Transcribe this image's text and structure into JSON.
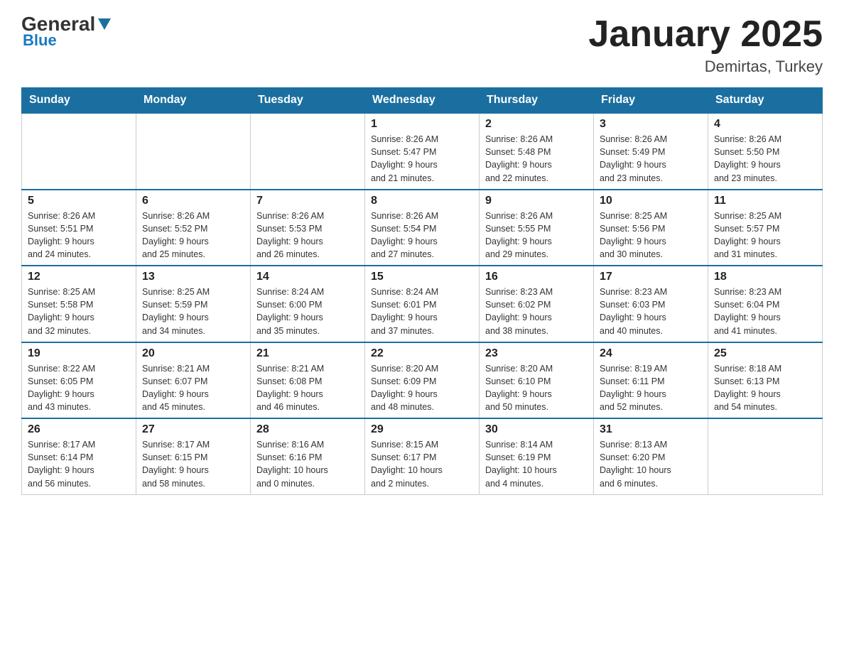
{
  "header": {
    "logo_general": "General",
    "logo_blue": "Blue",
    "month_year": "January 2025",
    "location": "Demirtas, Turkey"
  },
  "days_of_week": [
    "Sunday",
    "Monday",
    "Tuesday",
    "Wednesday",
    "Thursday",
    "Friday",
    "Saturday"
  ],
  "weeks": [
    [
      {
        "day": "",
        "info": ""
      },
      {
        "day": "",
        "info": ""
      },
      {
        "day": "",
        "info": ""
      },
      {
        "day": "1",
        "info": "Sunrise: 8:26 AM\nSunset: 5:47 PM\nDaylight: 9 hours\nand 21 minutes."
      },
      {
        "day": "2",
        "info": "Sunrise: 8:26 AM\nSunset: 5:48 PM\nDaylight: 9 hours\nand 22 minutes."
      },
      {
        "day": "3",
        "info": "Sunrise: 8:26 AM\nSunset: 5:49 PM\nDaylight: 9 hours\nand 23 minutes."
      },
      {
        "day": "4",
        "info": "Sunrise: 8:26 AM\nSunset: 5:50 PM\nDaylight: 9 hours\nand 23 minutes."
      }
    ],
    [
      {
        "day": "5",
        "info": "Sunrise: 8:26 AM\nSunset: 5:51 PM\nDaylight: 9 hours\nand 24 minutes."
      },
      {
        "day": "6",
        "info": "Sunrise: 8:26 AM\nSunset: 5:52 PM\nDaylight: 9 hours\nand 25 minutes."
      },
      {
        "day": "7",
        "info": "Sunrise: 8:26 AM\nSunset: 5:53 PM\nDaylight: 9 hours\nand 26 minutes."
      },
      {
        "day": "8",
        "info": "Sunrise: 8:26 AM\nSunset: 5:54 PM\nDaylight: 9 hours\nand 27 minutes."
      },
      {
        "day": "9",
        "info": "Sunrise: 8:26 AM\nSunset: 5:55 PM\nDaylight: 9 hours\nand 29 minutes."
      },
      {
        "day": "10",
        "info": "Sunrise: 8:25 AM\nSunset: 5:56 PM\nDaylight: 9 hours\nand 30 minutes."
      },
      {
        "day": "11",
        "info": "Sunrise: 8:25 AM\nSunset: 5:57 PM\nDaylight: 9 hours\nand 31 minutes."
      }
    ],
    [
      {
        "day": "12",
        "info": "Sunrise: 8:25 AM\nSunset: 5:58 PM\nDaylight: 9 hours\nand 32 minutes."
      },
      {
        "day": "13",
        "info": "Sunrise: 8:25 AM\nSunset: 5:59 PM\nDaylight: 9 hours\nand 34 minutes."
      },
      {
        "day": "14",
        "info": "Sunrise: 8:24 AM\nSunset: 6:00 PM\nDaylight: 9 hours\nand 35 minutes."
      },
      {
        "day": "15",
        "info": "Sunrise: 8:24 AM\nSunset: 6:01 PM\nDaylight: 9 hours\nand 37 minutes."
      },
      {
        "day": "16",
        "info": "Sunrise: 8:23 AM\nSunset: 6:02 PM\nDaylight: 9 hours\nand 38 minutes."
      },
      {
        "day": "17",
        "info": "Sunrise: 8:23 AM\nSunset: 6:03 PM\nDaylight: 9 hours\nand 40 minutes."
      },
      {
        "day": "18",
        "info": "Sunrise: 8:23 AM\nSunset: 6:04 PM\nDaylight: 9 hours\nand 41 minutes."
      }
    ],
    [
      {
        "day": "19",
        "info": "Sunrise: 8:22 AM\nSunset: 6:05 PM\nDaylight: 9 hours\nand 43 minutes."
      },
      {
        "day": "20",
        "info": "Sunrise: 8:21 AM\nSunset: 6:07 PM\nDaylight: 9 hours\nand 45 minutes."
      },
      {
        "day": "21",
        "info": "Sunrise: 8:21 AM\nSunset: 6:08 PM\nDaylight: 9 hours\nand 46 minutes."
      },
      {
        "day": "22",
        "info": "Sunrise: 8:20 AM\nSunset: 6:09 PM\nDaylight: 9 hours\nand 48 minutes."
      },
      {
        "day": "23",
        "info": "Sunrise: 8:20 AM\nSunset: 6:10 PM\nDaylight: 9 hours\nand 50 minutes."
      },
      {
        "day": "24",
        "info": "Sunrise: 8:19 AM\nSunset: 6:11 PM\nDaylight: 9 hours\nand 52 minutes."
      },
      {
        "day": "25",
        "info": "Sunrise: 8:18 AM\nSunset: 6:13 PM\nDaylight: 9 hours\nand 54 minutes."
      }
    ],
    [
      {
        "day": "26",
        "info": "Sunrise: 8:17 AM\nSunset: 6:14 PM\nDaylight: 9 hours\nand 56 minutes."
      },
      {
        "day": "27",
        "info": "Sunrise: 8:17 AM\nSunset: 6:15 PM\nDaylight: 9 hours\nand 58 minutes."
      },
      {
        "day": "28",
        "info": "Sunrise: 8:16 AM\nSunset: 6:16 PM\nDaylight: 10 hours\nand 0 minutes."
      },
      {
        "day": "29",
        "info": "Sunrise: 8:15 AM\nSunset: 6:17 PM\nDaylight: 10 hours\nand 2 minutes."
      },
      {
        "day": "30",
        "info": "Sunrise: 8:14 AM\nSunset: 6:19 PM\nDaylight: 10 hours\nand 4 minutes."
      },
      {
        "day": "31",
        "info": "Sunrise: 8:13 AM\nSunset: 6:20 PM\nDaylight: 10 hours\nand 6 minutes."
      },
      {
        "day": "",
        "info": ""
      }
    ]
  ]
}
